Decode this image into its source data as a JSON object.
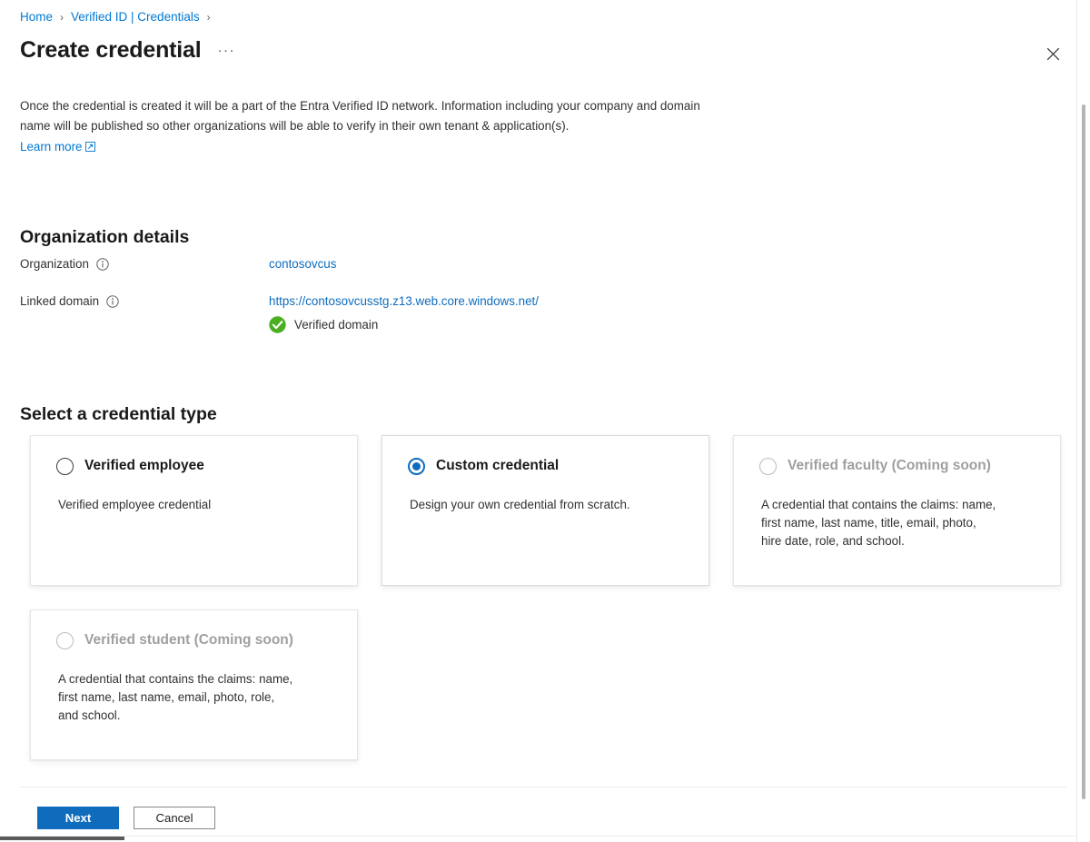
{
  "breadcrumb": {
    "items": [
      {
        "label": "Home"
      },
      {
        "label": "Verified ID | Credentials"
      }
    ],
    "separator": "›"
  },
  "header": {
    "title": "Create credential",
    "more_label": "···",
    "close_icon": "close-icon"
  },
  "intro": {
    "text": "Once the credential is created it will be a part of the Entra Verified ID network. Information including your company and domain name will be published so other organizations will be able to verify in their own tenant & application(s).",
    "learn_more_label": "Learn more"
  },
  "organization_section": {
    "heading": "Organization details",
    "rows": [
      {
        "label": "Organization",
        "value": "contosovcus",
        "info_icon": "info-icon"
      },
      {
        "label": "Linked domain",
        "value": "https://contosovcusstg.z13.web.core.windows.net/",
        "info_icon": "info-icon",
        "status_text": "Verified domain",
        "status_icon": "verified-check-icon"
      }
    ]
  },
  "credential_type_section": {
    "heading": "Select a credential type",
    "cards": [
      {
        "title": "Verified employee",
        "description": "Verified employee credential",
        "selected": false,
        "disabled": false
      },
      {
        "title": "Custom credential",
        "description": "Design your own credential from scratch.",
        "selected": true,
        "disabled": false
      },
      {
        "title": "Verified faculty (Coming soon)",
        "description": "A credential that contains the claims: name,\nfirst name, last name, title, email, photo,\nhire date, role, and school.",
        "selected": false,
        "disabled": true
      },
      {
        "title": "Verified student (Coming soon)",
        "description": "A credential that contains the claims: name,\nfirst name, last name, email, photo, role,\nand school.",
        "selected": false,
        "disabled": true
      }
    ]
  },
  "footer": {
    "next_label": "Next",
    "cancel_label": "Cancel"
  },
  "colors": {
    "link": "#0078d4",
    "link_value": "#0f6cbd",
    "primary_button": "#0f6cbd",
    "verified_green": "#4caf22",
    "disabled_text": "#a19f9d"
  }
}
